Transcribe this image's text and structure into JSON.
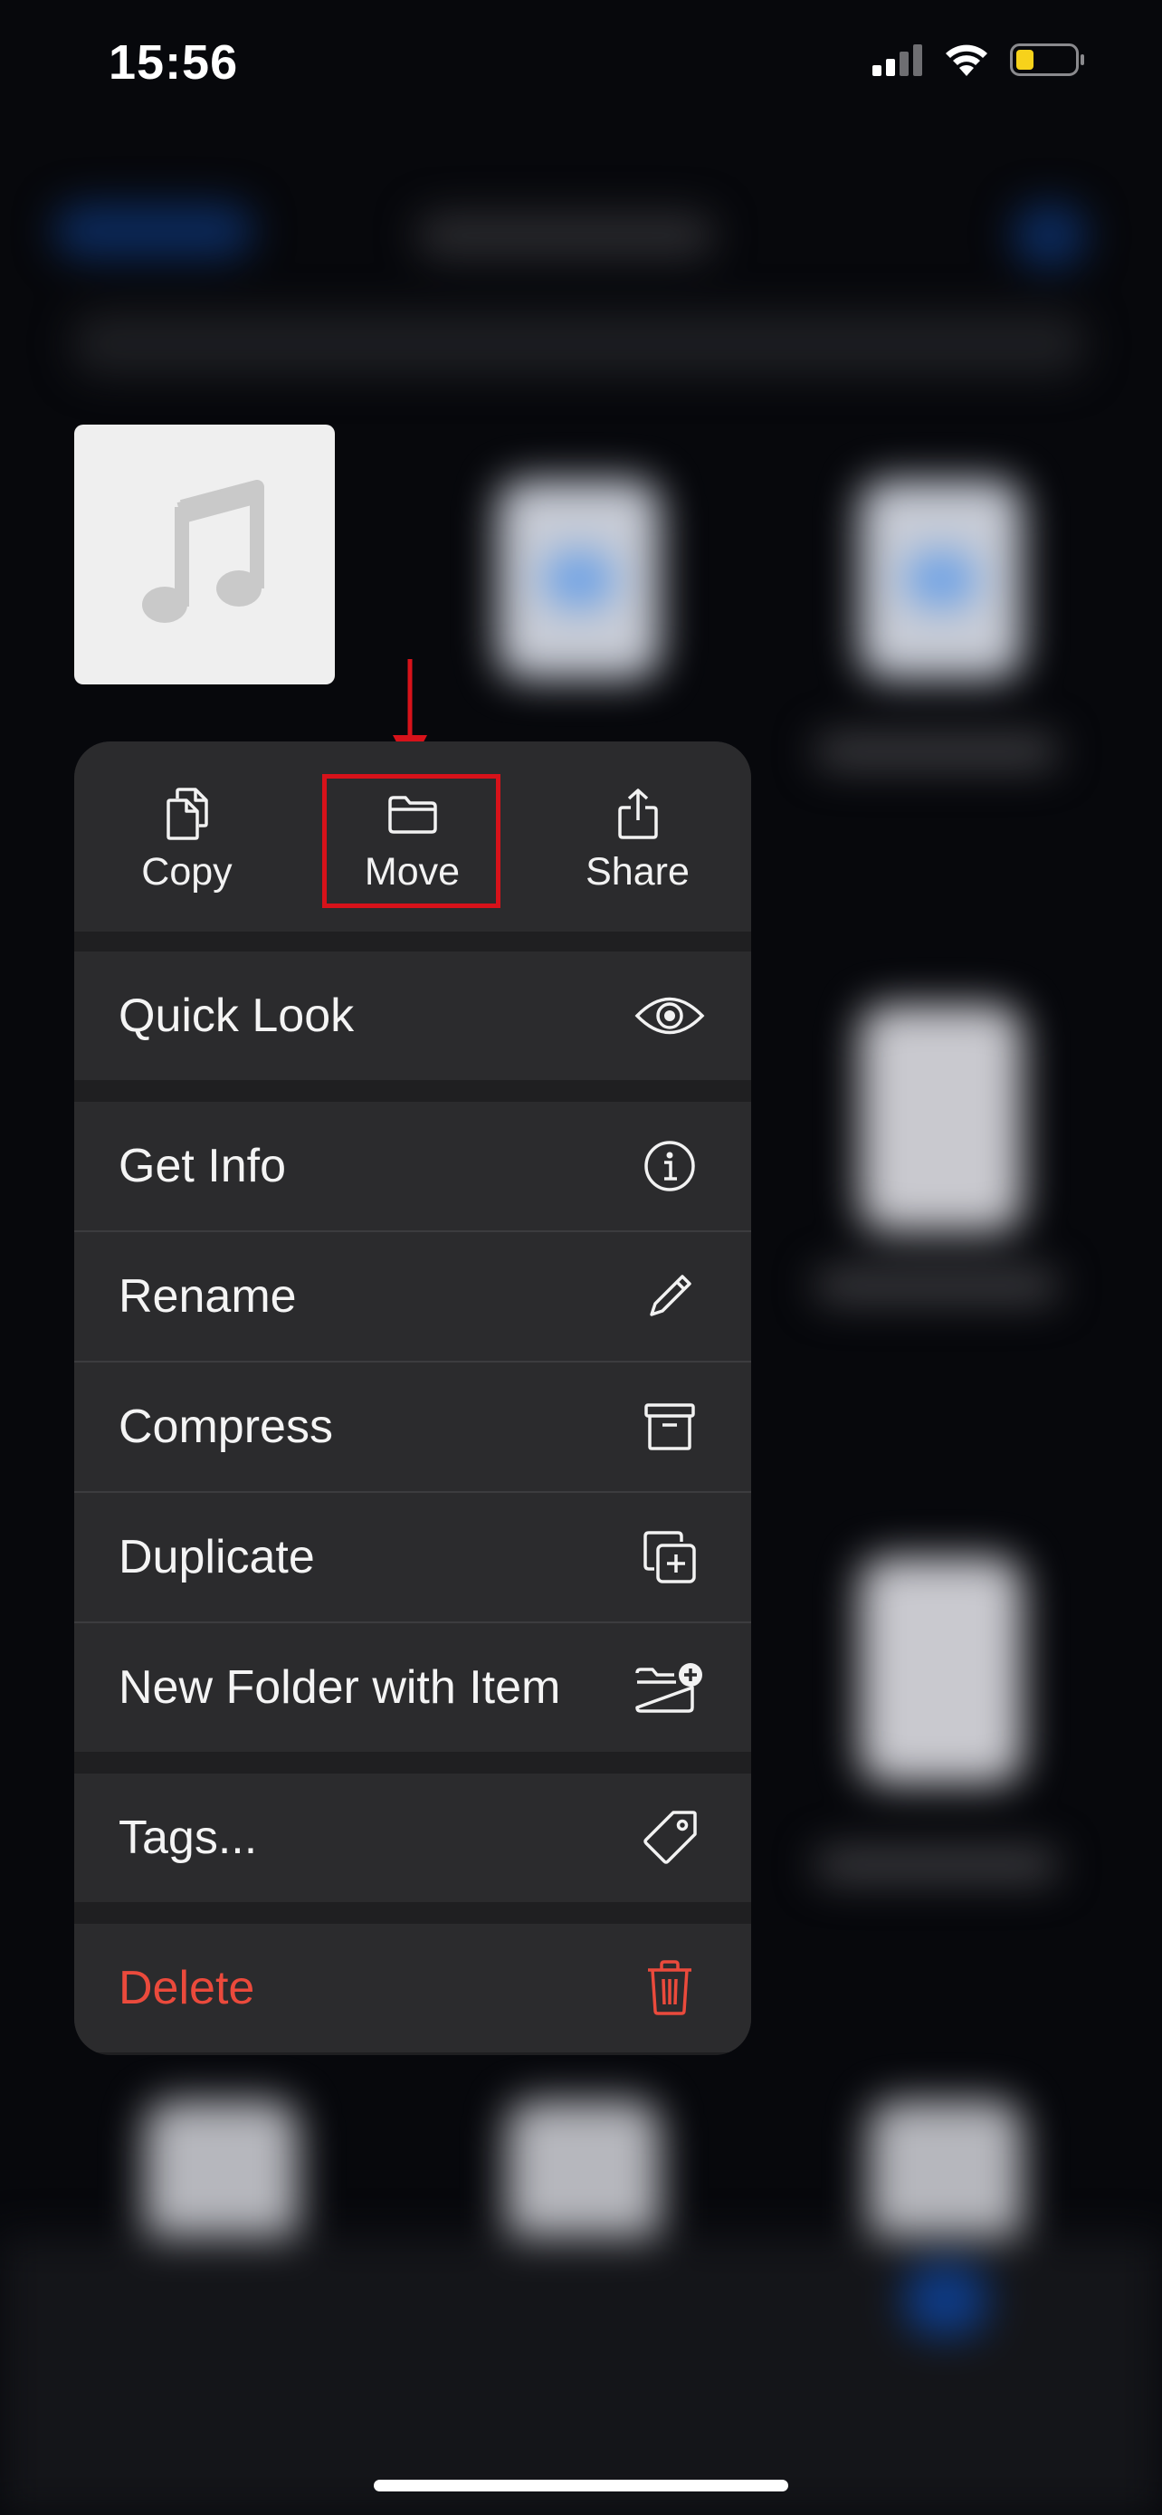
{
  "status_bar": {
    "time": "15:56"
  },
  "thumbnail": {
    "icon": "music-note-icon"
  },
  "menu": {
    "top_actions": [
      {
        "label": "Copy",
        "icon": "copy-icon"
      },
      {
        "label": "Move",
        "icon": "folder-icon"
      },
      {
        "label": "Share",
        "icon": "share-icon"
      }
    ],
    "items": [
      {
        "label": "Quick Look",
        "icon": "eye-icon"
      },
      {
        "label": "Get Info",
        "icon": "info-icon"
      },
      {
        "label": "Rename",
        "icon": "pencil-icon"
      },
      {
        "label": "Compress",
        "icon": "archive-box-icon"
      },
      {
        "label": "Duplicate",
        "icon": "duplicate-icon"
      },
      {
        "label": "New Folder with Item",
        "icon": "folder-plus-icon"
      },
      {
        "label": "Tags...",
        "icon": "tag-icon"
      },
      {
        "label": "Delete",
        "icon": "trash-icon"
      }
    ]
  },
  "colors": {
    "delete_red": "#eb4a3c",
    "annotation_red": "#d7121a",
    "menu_background": "#2b2b2d"
  }
}
